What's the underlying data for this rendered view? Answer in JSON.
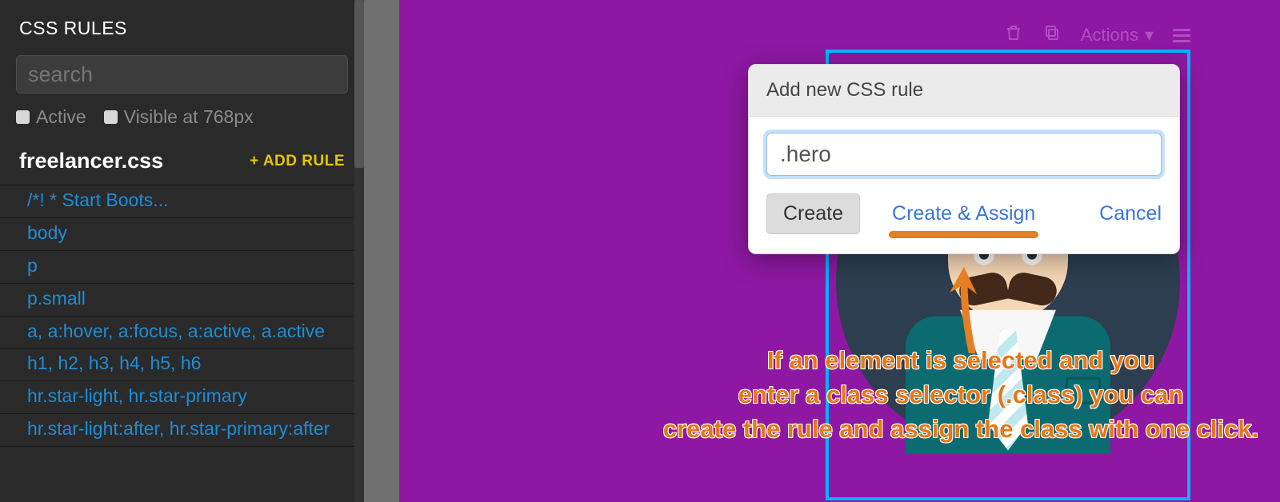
{
  "panel": {
    "title": "CSS RULES",
    "search_placeholder": "search",
    "filters": {
      "active_label": "Active",
      "visible_label": "Visible at 768px"
    },
    "stylesheet": "freelancer.css",
    "add_rule_label": "+ ADD RULE",
    "rules": [
      "/*! * Start Boots...",
      "body",
      "p",
      "p.small",
      "a, a:hover, a:focus, a:active, a.active",
      "h1, h2, h3, h4, h5, h6",
      "hr.star-light, hr.star-primary",
      "hr.star-light:after, hr.star-primary:after"
    ]
  },
  "popover": {
    "title": "Add new CSS rule",
    "input_value": ".hero",
    "create_label": "Create",
    "create_assign_label": "Create & Assign",
    "cancel_label": "Cancel"
  },
  "selection_toolbar": {
    "actions_label": "Actions",
    "caret": "▾"
  },
  "annotation": {
    "line1": "If an element is selected and you",
    "line2": "enter a class selector (.class) you can",
    "line3": "create the rule and assign the class with one click."
  }
}
